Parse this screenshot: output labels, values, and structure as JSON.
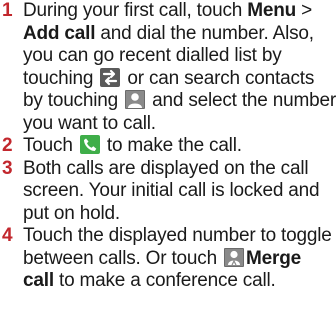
{
  "steps": [
    {
      "num": "1",
      "t1": "During your first call, touch ",
      "b1": "Menu",
      "t2": " > ",
      "b2": "Add call",
      "t3": " and dial the number. Also, you can go recent dialled list by touching ",
      "t4": " or can search contacts by touching ",
      "t5": " and select the number you want to call."
    },
    {
      "num": "2",
      "t1": "Touch ",
      "t2": " to make the call."
    },
    {
      "num": "3",
      "t1": "Both calls are displayed on the call screen. Your initial call is locked and put on hold."
    },
    {
      "num": "4",
      "t1": "Touch the displayed number to toggle between calls. Or touch ",
      "b1": "Merge call",
      "t2": " to make a conference call."
    }
  ],
  "icons": {
    "recent": "recent-calls-icon",
    "contacts": "contacts-icon",
    "call": "call-icon",
    "merge": "merge-call-icon"
  },
  "colors": {
    "number": "#c2272d",
    "text": "#1a1a1a",
    "call_icon": "#3fae49"
  }
}
